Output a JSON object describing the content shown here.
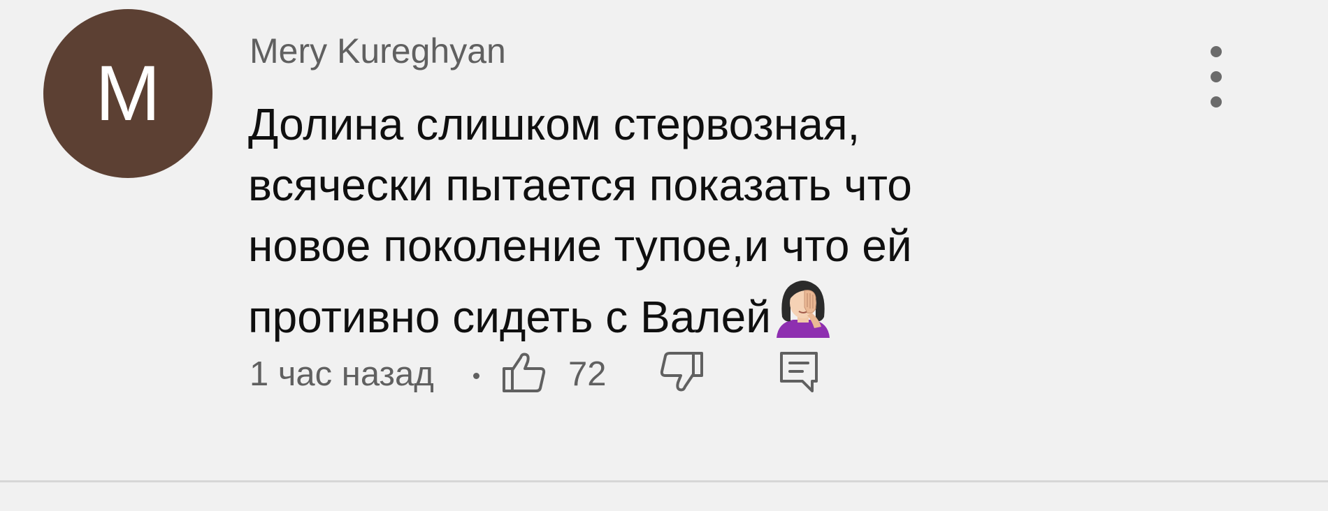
{
  "comment": {
    "avatar": {
      "initial": "M",
      "color": "#5c4033"
    },
    "author": "Mery Kureghyan",
    "text_lines": [
      "Долина слишком стервозная,",
      "всячески пытается показать что",
      "новое поколение тупое,и что ей",
      "противно сидеть с Валей"
    ],
    "emoji": "woman-facepalming-icon",
    "timestamp": "1 час назад",
    "separator": "•",
    "like_count": "72",
    "icons": {
      "menu": "more-vertical-icon",
      "like": "thumbs-up-icon",
      "dislike": "thumbs-down-icon",
      "reply": "reply-comment-icon"
    },
    "colors": {
      "text": "#0f0f0f",
      "secondary": "#606060",
      "background": "#f1f1f1"
    }
  }
}
